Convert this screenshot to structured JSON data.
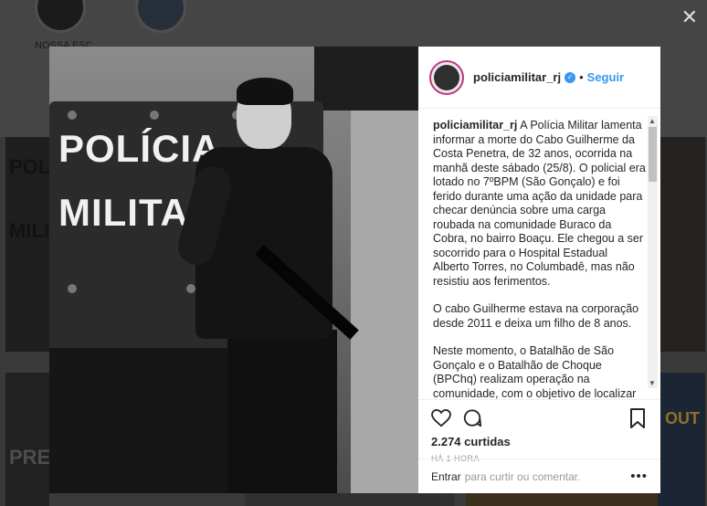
{
  "background": {
    "highlight_label": "NOSSA ESC",
    "tile_texts": [
      "POL",
      "MILI",
      "PRE",
      "OUT"
    ]
  },
  "post": {
    "username": "policiamilitar_rj",
    "follow_label": "Seguir",
    "caption_user": "policiamilitar_rj",
    "caption_paragraphs": [
      "A Polícia Militar lamenta informar a morte do Cabo Guilherme da Costa Penetra, de 32 anos, ocorrida na manhã deste sábado (25/8). O policial era lotado no 7ºBPM (São Gonçalo) e foi ferido durante uma ação da unidade para checar denúncia sobre uma carga roubada na comunidade Buraco da Cobra, no bairro Boaçu. Ele chegou a ser socorrido para o Hospital Estadual Alberto Torres, no Columbadê, mas não resistiu aos ferimentos.",
      "O cabo Guilherme estava na corporação desde 2011 e deixa um filho de 8 anos.",
      "Neste momento, o Batalhão de São Gonçalo e o Batalhão de Choque (BPChq) realizam operação na comunidade, com o objetivo de localizar os criminosos envolvidos no crime do policial"
    ],
    "likes": "2.274 curtidas",
    "time": "HÁ 1 HORA",
    "comment_link": "Entrar",
    "comment_placeholder": "para curtir ou comentar.",
    "more_label": "•••",
    "photo_text_line1": "POLÍCIA",
    "photo_text_line2": "MILITAR"
  },
  "icons": {
    "close": "close-icon",
    "verified": "verified-badge-icon",
    "like": "heart-icon",
    "comment": "comment-icon",
    "save": "bookmark-icon"
  },
  "colors": {
    "accent": "#3897f0",
    "avatar_ring": "#c13584",
    "text": "#262626",
    "muted": "#999999"
  }
}
